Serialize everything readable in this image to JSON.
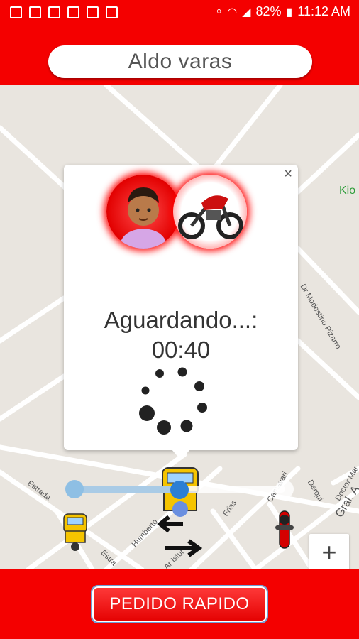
{
  "status_bar": {
    "battery": "82%",
    "time": "11:12 AM"
  },
  "header": {
    "user_name": "Aldo varas"
  },
  "map": {
    "streets": [
      "Estrada",
      "Humberto",
      "Frias",
      "Camavari",
      "Derqui",
      "Doctor Mar",
      "Gral. A",
      "Dr Modestino Pizarro",
      "Estra",
      "Ar Istur"
    ],
    "place": "Kio"
  },
  "popup": {
    "close": "×",
    "waiting_text": "Aguardando...:",
    "timer": "00:40"
  },
  "slider": {
    "value_fraction": 0.5
  },
  "zoom": {
    "label": "+"
  },
  "footer": {
    "button_label": "PEDIDO RAPIDO"
  },
  "colors": {
    "brand_red": "#f40000",
    "slider_blue": "#2b7fd4"
  }
}
